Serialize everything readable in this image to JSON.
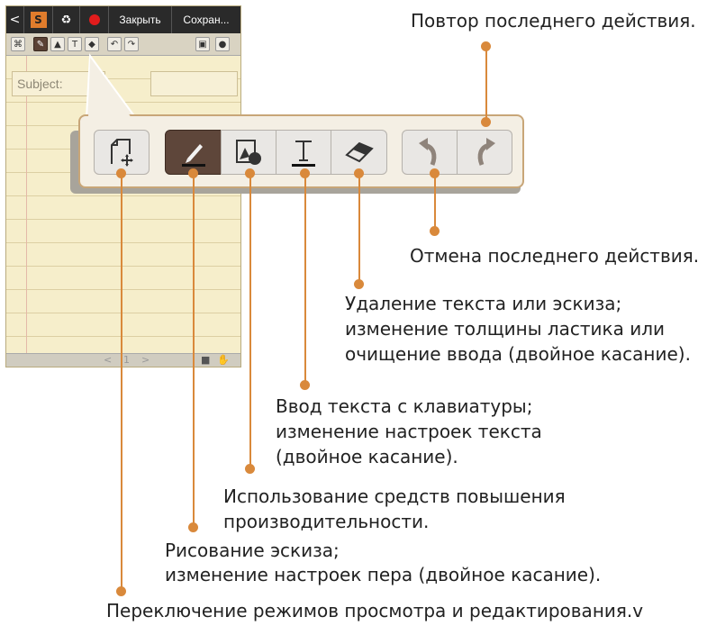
{
  "phone": {
    "topbar": {
      "back": "<",
      "s_label": "S",
      "close_label": "Закрыть",
      "save_label": "Сохран..."
    },
    "subject_placeholder": "Subject:",
    "bottombar": {
      "prev": "<",
      "page": "1",
      "next": ">"
    }
  },
  "annotations": {
    "redo": "Повтор последнего действия.",
    "undo": "Отмена последнего действия.",
    "eraser_line1": "Удаление текста или эскиза;",
    "eraser_line2": "изменение толщины ластика или",
    "eraser_line3": "очищение ввода (двойное касание).",
    "text_line1": "Ввод текста с клавиатуры;",
    "text_line2": "изменение настроек текста",
    "text_line3": "(двойное касание).",
    "shapes_line1": "Использование средств повышения",
    "shapes_line2": "производительности.",
    "pen_line1": "Рисование эскиза;",
    "pen_line2": "изменение настроек пера (двойное касание).",
    "mode_line1": "Переключение режимов просмотра и редактирования.v"
  },
  "colors": {
    "accent": "#d9893b",
    "active_tool": "#5e463a",
    "paper": "#f6eecb",
    "record": "#e21c1c"
  },
  "icons": [
    "back-icon",
    "s-pen-icon",
    "attach-icon",
    "record-icon",
    "mode-icon",
    "pen-icon",
    "shape-icon",
    "text-icon",
    "eraser-icon",
    "undo-icon",
    "redo-icon",
    "image-icon",
    "mic-icon"
  ]
}
